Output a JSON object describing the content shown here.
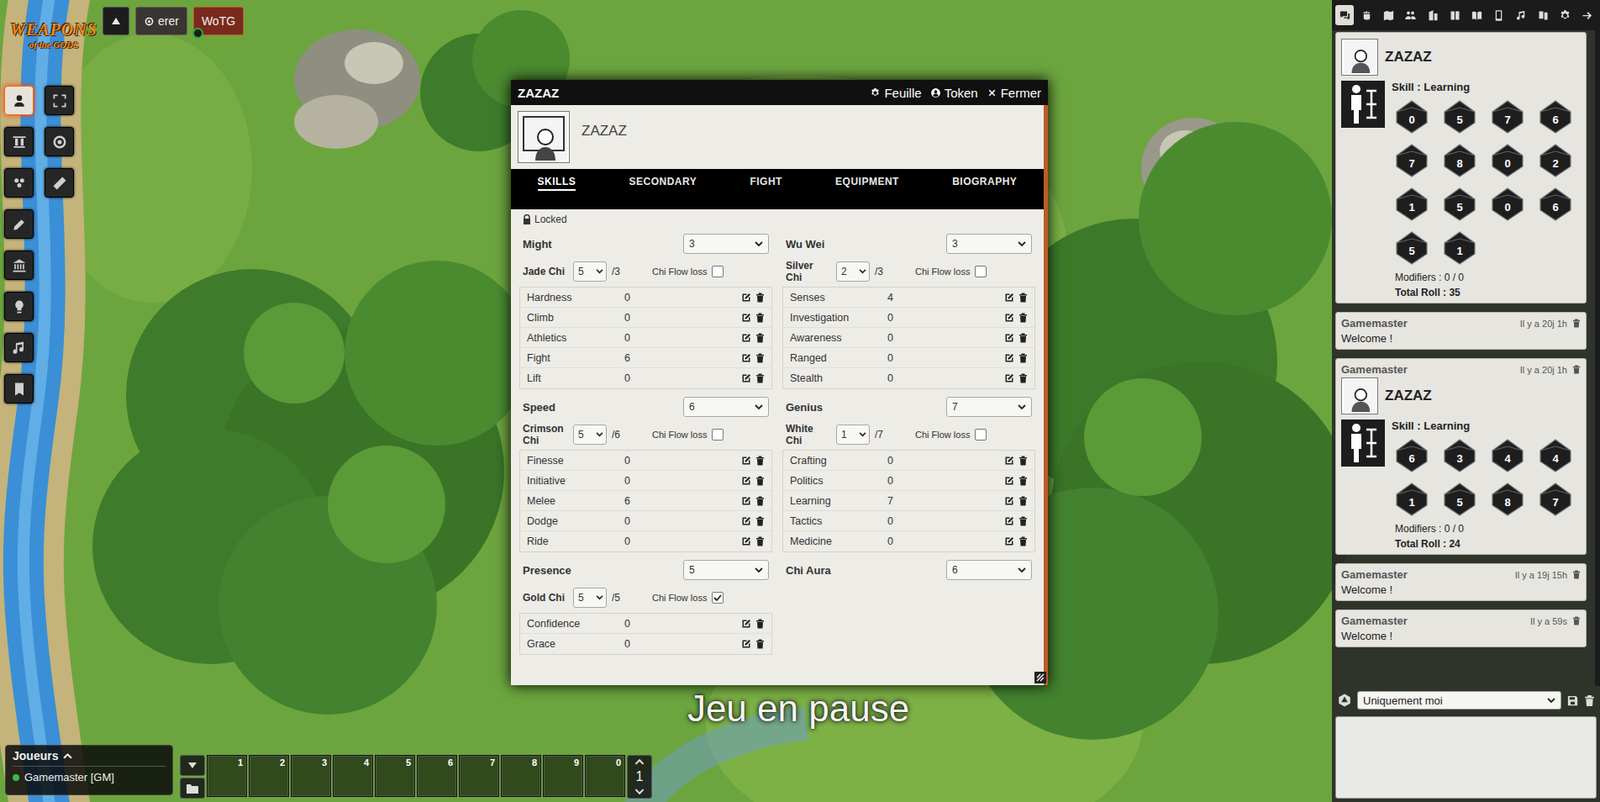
{
  "logo": {
    "title": "WEAPONS",
    "subtitle": "of the GODS"
  },
  "scenes": [
    {
      "label": "erer",
      "selected": false,
      "has_target": true,
      "online": false
    },
    {
      "label": "WoTG",
      "selected": true,
      "has_target": false,
      "online": true
    }
  ],
  "left_toolbar": {
    "tools": [
      {
        "selected": true
      },
      {
        "selected": false
      },
      {
        "selected": false
      },
      {
        "selected": false
      },
      {
        "selected": false
      },
      {
        "selected": false
      },
      {
        "selected": false
      },
      {
        "selected": false
      }
    ],
    "subtools": [
      {
        "selected": false
      },
      {
        "selected": false
      },
      {
        "selected": false
      }
    ]
  },
  "sheet": {
    "title": "ZAZAZ",
    "header_buttons": [
      {
        "label": "Feuille"
      },
      {
        "label": "Token"
      },
      {
        "label": "Fermer"
      }
    ],
    "name": "ZAZAZ",
    "tabs": [
      {
        "label": "SKILLS",
        "selected": true
      },
      {
        "label": "SECONDARY",
        "selected": false
      },
      {
        "label": "FIGHT",
        "selected": false
      },
      {
        "label": "EQUIPMENT",
        "selected": false
      },
      {
        "label": "BIOGRAPHY",
        "selected": false
      }
    ],
    "lock": {
      "label": "Locked",
      "locked": true
    },
    "columns": [
      [
        {
          "attribute": "Might",
          "value": "3",
          "chi": {
            "label": "Jade Chi",
            "value": "5",
            "max": "/3",
            "flow_label": "Chi Flow loss",
            "flow_loss": false
          },
          "skills": [
            {
              "name": "Hardness",
              "value": "0"
            },
            {
              "name": "Climb",
              "value": "0"
            },
            {
              "name": "Athletics",
              "value": "0"
            },
            {
              "name": "Fight",
              "value": "6"
            },
            {
              "name": "Lift",
              "value": "0"
            }
          ]
        },
        {
          "attribute": "Speed",
          "value": "6",
          "chi": {
            "label": "Crimson Chi",
            "value": "5",
            "max": "/6",
            "flow_label": "Chi Flow loss",
            "flow_loss": false
          },
          "skills": [
            {
              "name": "Finesse",
              "value": "0"
            },
            {
              "name": "Initiative",
              "value": "0"
            },
            {
              "name": "Melee",
              "value": "6"
            },
            {
              "name": "Dodge",
              "value": "0"
            },
            {
              "name": "Ride",
              "value": "0"
            }
          ]
        },
        {
          "attribute": "Presence",
          "value": "5",
          "chi": {
            "label": "Gold Chi",
            "value": "5",
            "max": "/5",
            "flow_label": "Chi Flow loss",
            "flow_loss": true
          },
          "skills": [
            {
              "name": "Confidence",
              "value": "0"
            },
            {
              "name": "Grace",
              "value": "0"
            }
          ]
        }
      ],
      [
        {
          "attribute": "Wu Wei",
          "value": "3",
          "chi": {
            "label": "Silver Chi",
            "value": "2",
            "max": "/3",
            "flow_label": "Chi Flow loss",
            "flow_loss": false
          },
          "skills": [
            {
              "name": "Senses",
              "value": "4"
            },
            {
              "name": "Investigation",
              "value": "0"
            },
            {
              "name": "Awareness",
              "value": "0"
            },
            {
              "name": "Ranged",
              "value": "0"
            },
            {
              "name": "Stealth",
              "value": "0"
            }
          ]
        },
        {
          "attribute": "Genius",
          "value": "7",
          "chi": {
            "label": "White Chi",
            "value": "1",
            "max": "/7",
            "flow_label": "Chi Flow loss",
            "flow_loss": false
          },
          "skills": [
            {
              "name": "Crafting",
              "value": "0"
            },
            {
              "name": "Politics",
              "value": "0"
            },
            {
              "name": "Learning",
              "value": "7"
            },
            {
              "name": "Tactics",
              "value": "0"
            },
            {
              "name": "Medicine",
              "value": "0"
            }
          ]
        },
        {
          "attribute": "Chi Aura",
          "value": "6"
        }
      ]
    ]
  },
  "pause_text": "Jeu en pause",
  "players": {
    "title": "Joueurs",
    "expanded": true,
    "list": [
      {
        "name": "Gamemaster [GM]",
        "online": true
      }
    ]
  },
  "hotbar": {
    "slots": [
      "1",
      "2",
      "3",
      "4",
      "5",
      "6",
      "7",
      "8",
      "9",
      "0"
    ],
    "page": "1"
  },
  "sidebar": {
    "tabs": [
      {
        "selected": true
      },
      {
        "selected": false
      },
      {
        "selected": false
      },
      {
        "selected": false
      },
      {
        "selected": false
      },
      {
        "selected": false
      },
      {
        "selected": false
      },
      {
        "selected": false
      },
      {
        "selected": false
      },
      {
        "selected": false
      },
      {
        "selected": false
      },
      {
        "selected": false
      }
    ],
    "messages": [
      {
        "kind": "roll",
        "actor": "ZAZAZ",
        "roll_title": "Skill : Learning",
        "dice": [
          "0",
          "5",
          "7",
          "6",
          "7",
          "8",
          "0",
          "2",
          "1",
          "5",
          "0",
          "6",
          "5",
          "1"
        ],
        "modifiers": "Modifiers : 0 / 0",
        "total": "Total Roll : 35"
      },
      {
        "kind": "text",
        "speaker": "Gamemaster",
        "time": "Il y a 20j 1h",
        "text": "Welcome !"
      },
      {
        "kind": "roll",
        "speaker": "Gamemaster",
        "time": "Il y a 20j 1h",
        "actor": "ZAZAZ",
        "roll_title": "Skill : Learning",
        "dice": [
          "6",
          "3",
          "4",
          "4",
          "1",
          "5",
          "8",
          "7"
        ],
        "modifiers": "Modifiers : 0 / 0",
        "total": "Total Roll : 24"
      },
      {
        "kind": "text",
        "speaker": "Gamemaster",
        "time": "Il y a 19j 15h",
        "text": "Welcome !"
      },
      {
        "kind": "text",
        "speaker": "Gamemaster",
        "time": "Il y a 59s",
        "text": "Welcome !"
      }
    ],
    "roll_mode": "Uniquement moi"
  }
}
